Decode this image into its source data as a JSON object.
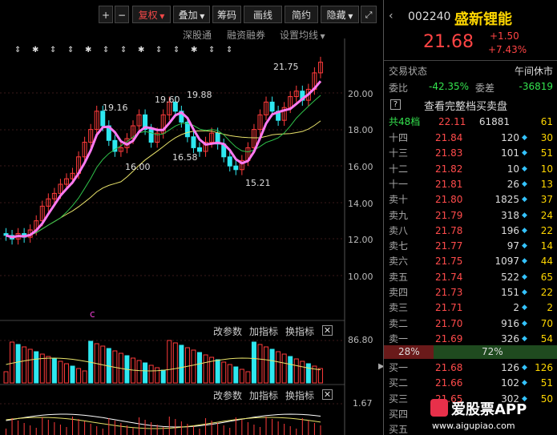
{
  "toolbar": {
    "plus": "+",
    "minus": "−",
    "restore_rights": "复权",
    "overlay": "叠加",
    "chips": "筹码",
    "draw_line": "画线",
    "simple": "简约",
    "hide": "隐藏"
  },
  "submenu": {
    "shenzhen_hk": "深股通",
    "margin": "融资融券",
    "set_ma": "设置均线"
  },
  "main_chart": {
    "high_label": "21.75",
    "price_axis": [
      "20.00",
      "18.00",
      "16.00",
      "14.00",
      "12.00",
      "10.00"
    ],
    "annotations": [
      "19.16",
      "19.60",
      "19.88",
      "16.00",
      "16.58",
      "15.21"
    ],
    "c_marker": "c"
  },
  "indicator1": {
    "edit_params": "改参数",
    "add_indicator": "加指标",
    "switch_indicator": "换指标",
    "value": "86.80"
  },
  "indicator2": {
    "edit_params": "改参数",
    "add_indicator": "加指标",
    "switch_indicator": "换指标",
    "value": "1.67"
  },
  "quote": {
    "code": "002240",
    "name": "盛新锂能",
    "price": "21.68",
    "change": "+1.50",
    "change_pct": "+7.43%",
    "trade_status_label": "交易状态",
    "trade_status": "午间休市",
    "weibi_label": "委比",
    "weibi": "-42.35%",
    "weicha_label": "委差",
    "weicha": "-36819",
    "help": "?",
    "view_full": "查看完整档买卖盘",
    "total_label": "共48档",
    "total_price": "22.11",
    "total_vol": "61881",
    "total_cnt": "61",
    "asks": [
      {
        "label": "十四",
        "price": "21.84",
        "vol": "120",
        "cnt": "30"
      },
      {
        "label": "十三",
        "price": "21.83",
        "vol": "101",
        "cnt": "51"
      },
      {
        "label": "十二",
        "price": "21.82",
        "vol": "10",
        "cnt": "10"
      },
      {
        "label": "十一",
        "price": "21.81",
        "vol": "26",
        "cnt": "13"
      },
      {
        "label": "卖十",
        "price": "21.80",
        "vol": "1825",
        "cnt": "37"
      },
      {
        "label": "卖九",
        "price": "21.79",
        "vol": "318",
        "cnt": "24"
      },
      {
        "label": "卖八",
        "price": "21.78",
        "vol": "196",
        "cnt": "22"
      },
      {
        "label": "卖七",
        "price": "21.77",
        "vol": "97",
        "cnt": "14"
      },
      {
        "label": "卖六",
        "price": "21.75",
        "vol": "1097",
        "cnt": "44"
      },
      {
        "label": "卖五",
        "price": "21.74",
        "vol": "522",
        "cnt": "65"
      },
      {
        "label": "卖四",
        "price": "21.73",
        "vol": "151",
        "cnt": "22"
      },
      {
        "label": "卖三",
        "price": "21.71",
        "vol": "2",
        "cnt": "2"
      },
      {
        "label": "卖二",
        "price": "21.70",
        "vol": "916",
        "cnt": "70"
      },
      {
        "label": "卖一",
        "price": "21.69",
        "vol": "326",
        "cnt": "54"
      }
    ],
    "ratio_sell": "28%",
    "ratio_buy": "72%",
    "bids": [
      {
        "label": "买一",
        "price": "21.68",
        "vol": "126",
        "cnt": "126"
      },
      {
        "label": "买二",
        "price": "21.66",
        "vol": "102",
        "cnt": "51"
      },
      {
        "label": "买三",
        "price": "21.65",
        "vol": "302",
        "cnt": "50"
      },
      {
        "label": "买四",
        "price": "",
        "vol": "",
        "cnt": ""
      },
      {
        "label": "买五",
        "price": "",
        "vol": "",
        "cnt": ""
      }
    ]
  },
  "watermark": {
    "brand": "爱股票APP",
    "url": "www.aigupiao.com"
  }
}
